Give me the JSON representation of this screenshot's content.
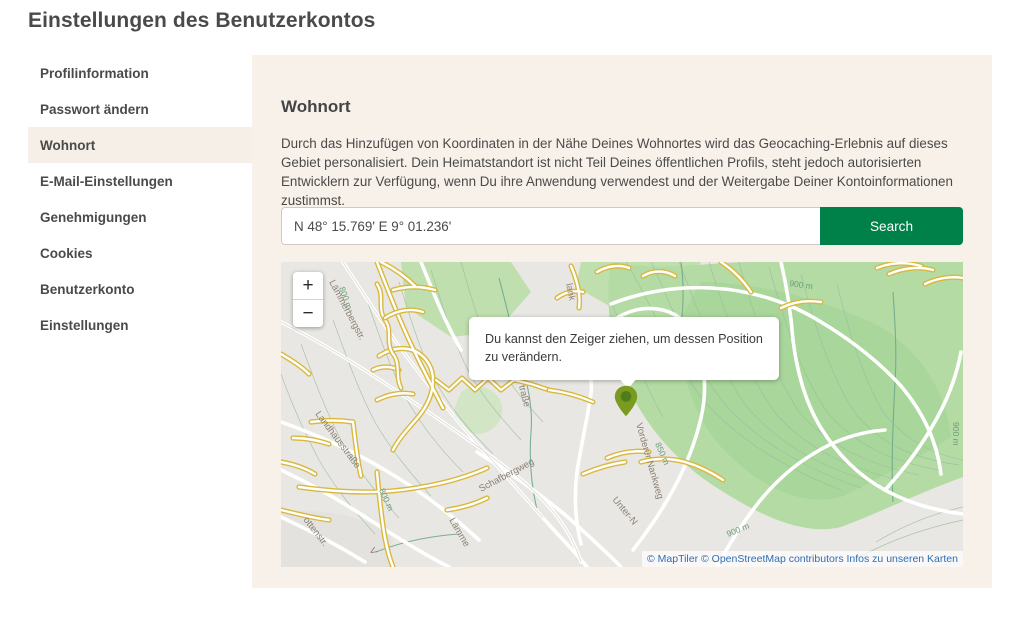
{
  "page": {
    "title": "Einstellungen des Benutzerkontos"
  },
  "sidebar": {
    "items": [
      {
        "label": "Profilinformation",
        "active": false
      },
      {
        "label": "Passwort ändern",
        "active": false
      },
      {
        "label": "Wohnort",
        "active": true
      },
      {
        "label": "E-Mail-Einstellungen",
        "active": false
      },
      {
        "label": "Genehmigungen",
        "active": false
      },
      {
        "label": "Cookies",
        "active": false
      },
      {
        "label": "Benutzerkonto",
        "active": false
      },
      {
        "label": "Einstellungen",
        "active": false
      }
    ]
  },
  "content": {
    "section_title": "Wohnort",
    "description": "Durch das Hinzufügen von Koordinaten in der Nähe Deines Wohnortes wird das Geocaching-Erlebnis auf dieses Gebiet personalisiert. Dein Heimatstandort ist nicht Teil Deines öffentlichen Profils, steht jedoch autorisierten Entwicklern zur Verfügung, wenn Du ihre Anwendung verwendest und der Weitergabe Deiner Kontoinformationen zustimmst.",
    "search": {
      "coordinates_value": "N 48° 15.769' E 9° 01.236'",
      "coordinates_placeholder": "N 48° 15.769' E 9° 01.236'",
      "search_button_label": "Search"
    }
  },
  "map": {
    "zoom_in_label": "+",
    "zoom_out_label": "−",
    "popup_text": "Du kannst den Zeiger ziehen, um dessen Position zu verändern.",
    "attribution": {
      "maptiler": "© MapTiler",
      "osm": "© OpenStreetMap contributors",
      "info": "Infos zu unseren Karten"
    },
    "street_labels": [
      "Landhausstraße",
      "Lämmerbergstr.",
      "Schafbergweg",
      "Lämmer",
      "Vorderer Nankweg",
      "Unter-N",
      "lank",
      "ottenstr.",
      "traße"
    ],
    "contour_labels": [
      "800 m",
      "850 m",
      "900 m",
      "900 m",
      "900 m"
    ],
    "marker_color": "#7a9a20",
    "marker_inner_color": "#4f7d1e"
  },
  "colors": {
    "panel_background": "#f8f1ea",
    "accent_green": "#01814a",
    "active_nav_background": "#f6efe8",
    "text_dark": "#4a4a4a",
    "link_blue": "#2f6db5"
  }
}
